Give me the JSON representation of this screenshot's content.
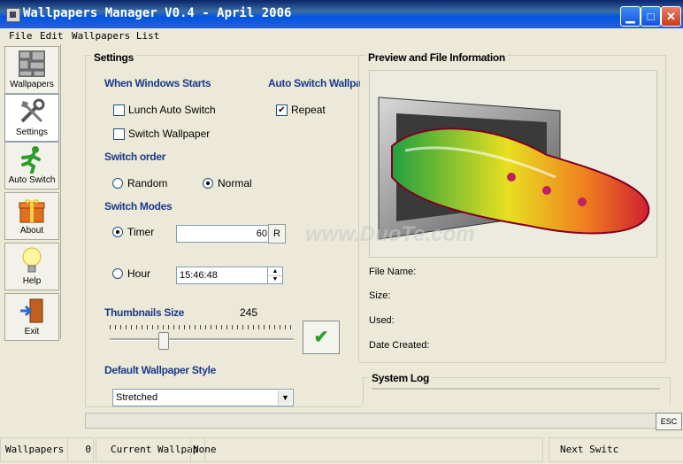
{
  "window": {
    "title": "Wallpapers Manager V0.4 - April 2006"
  },
  "menu": [
    "File",
    "Edit",
    "Wallpapers List"
  ],
  "nav": [
    {
      "label": "Wallpapers",
      "icon": "wallpapers-icon"
    },
    {
      "label": "Settings",
      "icon": "tools-icon"
    },
    {
      "label": "Auto Switch",
      "icon": "running-man-icon"
    },
    {
      "label": "About",
      "icon": "gift-box-icon"
    },
    {
      "label": "Help",
      "icon": "lightbulb-icon"
    },
    {
      "label": "Exit",
      "icon": "exit-door-icon"
    }
  ],
  "settings": {
    "title": "Settings",
    "when_windows_starts": "When Windows Starts",
    "lunch_auto_switch": "Lunch Auto Switch",
    "switch_wallpaper": "Switch Wallpaper",
    "auto_switch_wallpaper": "Auto Switch Wallpa",
    "repeat": "Repeat",
    "switch_order": "Switch order",
    "random": "Random",
    "normal": "Normal",
    "switch_modes": "Switch Modes",
    "timer": "Timer",
    "timer_value": "60",
    "timer_unit_button": "R",
    "hour": "Hour",
    "hour_value": "15:46:48",
    "thumbnails_size": "Thumbnails Size",
    "thumbnails_value": "245",
    "slider_fraction": 0.28,
    "default_style": "Default Wallpaper Style",
    "style_value": "Stretched"
  },
  "preview": {
    "title": "Preview and File Information",
    "file_name": "File Name:",
    "size": "Size:",
    "used": "Used:",
    "date_created": "Date Created:"
  },
  "system_log": {
    "title": "System Log"
  },
  "esc_button": "ESC",
  "statusbar": {
    "wallpapers_label": "Wallpapers",
    "wallpapers_count": "0",
    "current_label": "Current Wallpap",
    "current_value": "None",
    "next_label": "Next Switc"
  },
  "watermark": "www.DuoTe.com",
  "colors": {
    "title_bar": "#0054e3",
    "accent_green": "#2a9d2a",
    "sub_heading": "#1a3a8a"
  }
}
